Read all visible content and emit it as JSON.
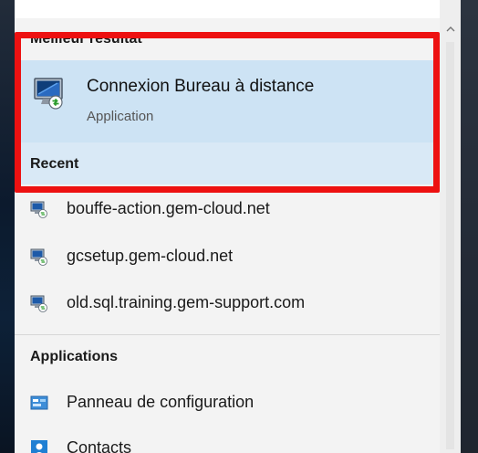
{
  "best_match": {
    "header": "Meilleur résultat",
    "title": "Connexion Bureau à distance",
    "subtitle": "Application",
    "icon": "remote-desktop-icon"
  },
  "recent": {
    "header": "Recent",
    "items": [
      {
        "label": "bouffe-action.gem-cloud.net",
        "icon": "rdp-file-icon"
      },
      {
        "label": "gcsetup.gem-cloud.net",
        "icon": "rdp-file-icon"
      },
      {
        "label": "old.sql.training.gem-support.com",
        "icon": "rdp-file-icon"
      }
    ]
  },
  "applications": {
    "header": "Applications",
    "items": [
      {
        "label": "Panneau de configuration",
        "icon": "control-panel-icon"
      },
      {
        "label": "Contacts",
        "icon": "contacts-icon"
      }
    ]
  },
  "colors": {
    "highlight": "#cde3f4",
    "annotation_box": "#ed1111",
    "panel_bg": "#f3f3f3"
  }
}
